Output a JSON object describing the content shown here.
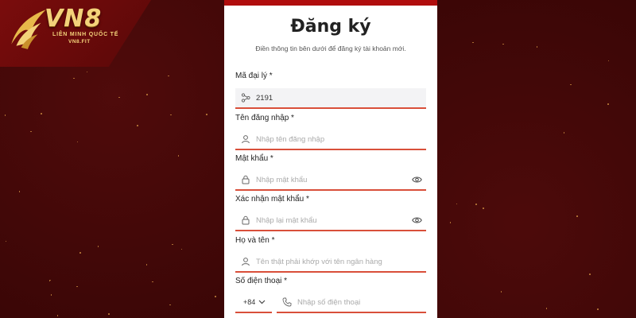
{
  "logo": {
    "brand": "VN8",
    "tagline": "LIÊN MINH QUỐC TẾ",
    "domain": "VN8.FIT"
  },
  "form": {
    "title": "Đăng ký",
    "subtitle": "Điền thông tin bên dưới để đăng ký tài khoản mới.",
    "fields": [
      {
        "label": "Mã đại lý *",
        "value": "2191",
        "placeholder": "",
        "icon": "share-icon"
      },
      {
        "label": "Tên đăng nhập *",
        "value": "",
        "placeholder": "Nhập tên đăng nhập",
        "icon": "user-icon"
      },
      {
        "label": "Mật khẩu *",
        "value": "",
        "placeholder": "Nhập mật khẩu",
        "icon": "lock-icon"
      },
      {
        "label": "Xác nhận mật khẩu *",
        "value": "",
        "placeholder": "Nhập lại mật khẩu",
        "icon": "lock-icon"
      },
      {
        "label": "Họ và tên *",
        "value": "",
        "placeholder": "Tên thật phải khớp với tên ngân hàng",
        "icon": "user-icon"
      },
      {
        "label": "Số điện thoại *",
        "value": "",
        "placeholder": "Nhập số điện thoại",
        "icon": "phone-icon",
        "country_code": "+84"
      }
    ]
  },
  "colors": {
    "background": "#3a0606",
    "accent": "#b00d0d",
    "underline": "#d94f3a",
    "gold": "#f3d27a"
  }
}
